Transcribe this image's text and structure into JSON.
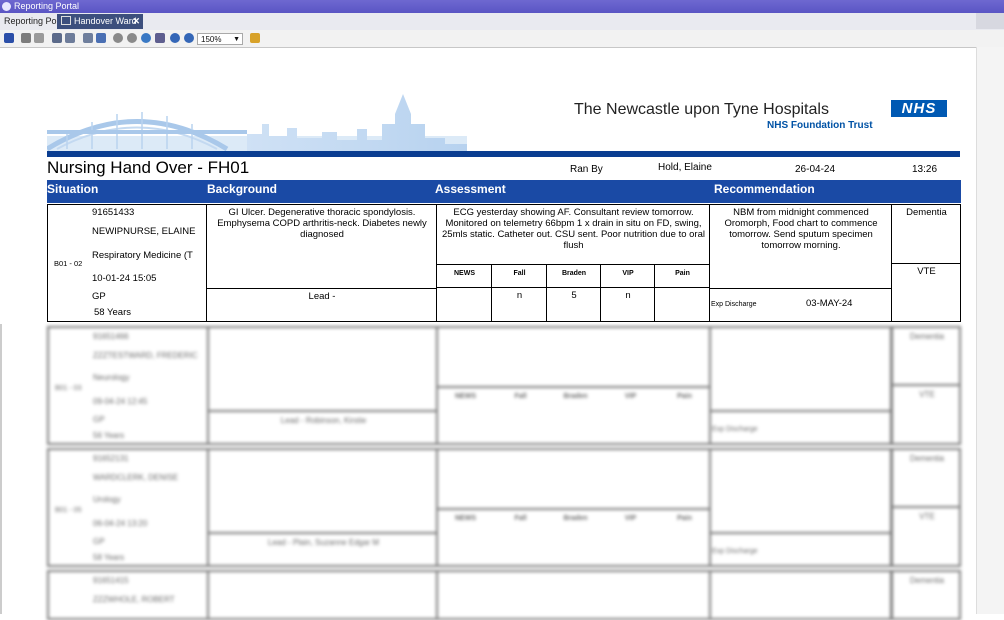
{
  "app": {
    "title": "Reporting Portal"
  },
  "tabs": [
    {
      "label": "Reporting Portal"
    },
    {
      "label": "Handover Ward"
    }
  ],
  "toolbar": {
    "zoom": "150%"
  },
  "header": {
    "hospital": "The Newcastle upon Tyne Hospitals",
    "trust": "NHS Foundation Trust",
    "nhs_logo": "NHS",
    "report_title": "Nursing Hand Over - FH01",
    "ran_by_label": "Ran By",
    "ran_by": "Hold, Elaine",
    "date": "26-04-24",
    "time": "13:26"
  },
  "sections": {
    "situation": "Situation",
    "background": "Background",
    "assessment": "Assessment",
    "recommendation": "Recommendation"
  },
  "patients": [
    {
      "bed": "B01 - 02",
      "mrn": "91651433",
      "name": "NEWIPNURSE, ELAINE",
      "specialty": "Respiratory Medicine (T",
      "admitted": "10-01-24 15:05",
      "gp": "GP",
      "age": "58 Years",
      "background": "GI Ulcer. Degenerative thoracic spondylosis. Emphysema COPD arthritis-neck. Diabetes newly diagnosed",
      "lead": "Lead -",
      "assessment": "ECG yesterday showing AF. Consultant review tomorrow. Monitored on telemetry 66bpm 1 x drain in situ on FD, swing, 25mls static. Catheter out. CSU sent. Poor nutrition due to oral flush",
      "score_headers": [
        "NEWS",
        "Fall",
        "Braden",
        "VIP",
        "Pain"
      ],
      "scores": [
        "",
        "n",
        "5",
        "n",
        ""
      ],
      "recommendation": "NBM from midnight commenced Oromorph, Food chart to commence tomorrow. Send sputum specimen tomorrow morning.",
      "exp_discharge_label": "Exp Discharge",
      "exp_discharge": "03-MAY-24",
      "flag1": "Dementia",
      "flag2": "VTE"
    },
    {
      "bed": "B01 - 03",
      "mrn": "91651466",
      "name": "ZZZTESTWARD, FREDERIC",
      "specialty": "Neurology",
      "admitted": "09-04-24 12:45",
      "gp": "GP",
      "age": "56 Years",
      "lead": "Lead - Robinson, Kirstie",
      "score_headers": [
        "NEWS",
        "Fall",
        "Braden",
        "VIP",
        "Pain"
      ],
      "exp_discharge_label": "Exp Discharge",
      "flag1": "Dementia",
      "flag2": "VTE"
    },
    {
      "bed": "B01 - 05",
      "mrn": "91652131",
      "name": "WARDCLERK, DENISE",
      "specialty": "Urology",
      "admitted": "06-04-24 13:20",
      "gp": "GP",
      "age": "58 Years",
      "lead": "Lead - Plain, Suzanne Edgar M",
      "score_headers": [
        "NEWS",
        "Fall",
        "Braden",
        "VIP",
        "Pain"
      ],
      "exp_discharge_label": "Exp Discharge",
      "flag1": "Dementia",
      "flag2": "VTE"
    },
    {
      "mrn": "91651415",
      "name": "ZZZWHOLE, ROBERT",
      "flag1": "Dementia"
    }
  ]
}
